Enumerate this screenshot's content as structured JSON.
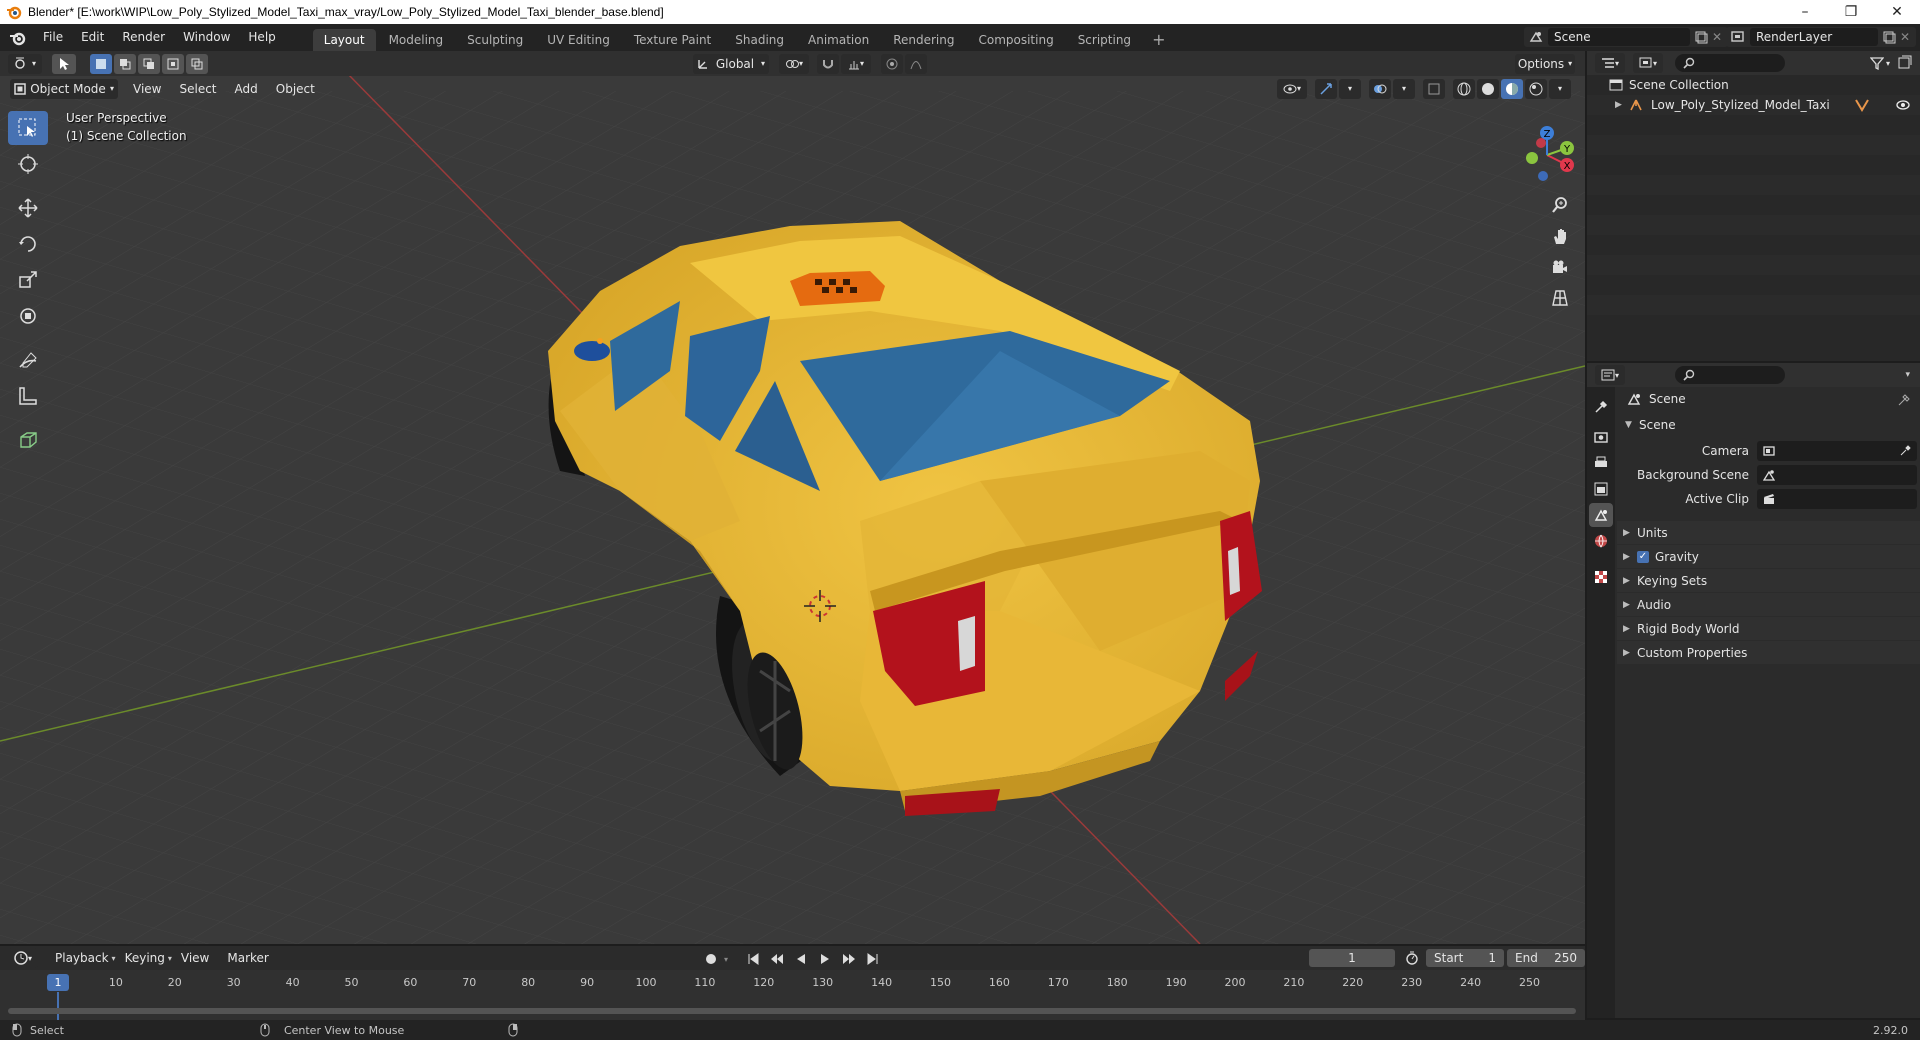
{
  "window": {
    "title": "Blender* [E:\\work\\WIP\\Low_Poly_Stylized_Model_Taxi_max_vray/Low_Poly_Stylized_Model_Taxi_blender_base.blend]",
    "controls": [
      "–",
      "❐",
      "✕"
    ]
  },
  "menu": [
    "File",
    "Edit",
    "Render",
    "Window",
    "Help"
  ],
  "workspaces": [
    {
      "label": "Layout",
      "active": true
    },
    {
      "label": "Modeling"
    },
    {
      "label": "Sculpting"
    },
    {
      "label": "UV Editing"
    },
    {
      "label": "Texture Paint"
    },
    {
      "label": "Shading"
    },
    {
      "label": "Animation"
    },
    {
      "label": "Rendering"
    },
    {
      "label": "Compositing"
    },
    {
      "label": "Scripting"
    }
  ],
  "scene_selector": "Scene",
  "render_layer": "RenderLayer",
  "viewport": {
    "transform_orientation": "Global",
    "options_label": "Options",
    "mode": "Object Mode",
    "menus": [
      "View",
      "Select",
      "Add",
      "Object"
    ],
    "overlay_line1": "User Perspective",
    "overlay_line2": "(1) Scene Collection",
    "gizmo_axes": [
      "X",
      "Y",
      "Z"
    ]
  },
  "timeline": {
    "menus": [
      "Playback",
      "Keying",
      "View",
      "Marker"
    ],
    "current_frame": "1",
    "start_label": "Start",
    "start": "1",
    "end_label": "End",
    "end": "250",
    "ticks": [
      "10",
      "20",
      "30",
      "40",
      "50",
      "60",
      "70",
      "80",
      "90",
      "100",
      "110",
      "120",
      "130",
      "140",
      "150",
      "160",
      "170",
      "180",
      "190",
      "200",
      "210",
      "220",
      "230",
      "240",
      "250"
    ],
    "cursor_label": "1"
  },
  "statusbar": {
    "select": "Select",
    "center_view": "Center View to Mouse",
    "version": "2.92.0"
  },
  "outliner": {
    "root": "Scene Collection",
    "items": [
      "Low_Poly_Stylized_Model_Taxi"
    ]
  },
  "properties": {
    "context_title": "Scene",
    "section_scene": "Scene",
    "props": [
      {
        "label": "Camera"
      },
      {
        "label": "Background Scene"
      },
      {
        "label": "Active Clip"
      }
    ],
    "panels": [
      {
        "label": "Units"
      },
      {
        "label": "Gravity",
        "checked": true
      },
      {
        "label": "Keying Sets"
      },
      {
        "label": "Audio"
      },
      {
        "label": "Rigid Body World"
      },
      {
        "label": "Custom Properties"
      }
    ]
  },
  "colors": {
    "accent": "#4772b3",
    "taxi_yellow": "#e8b830",
    "taxi_glass": "#2f6a9c",
    "taillight": "#b3121c"
  }
}
